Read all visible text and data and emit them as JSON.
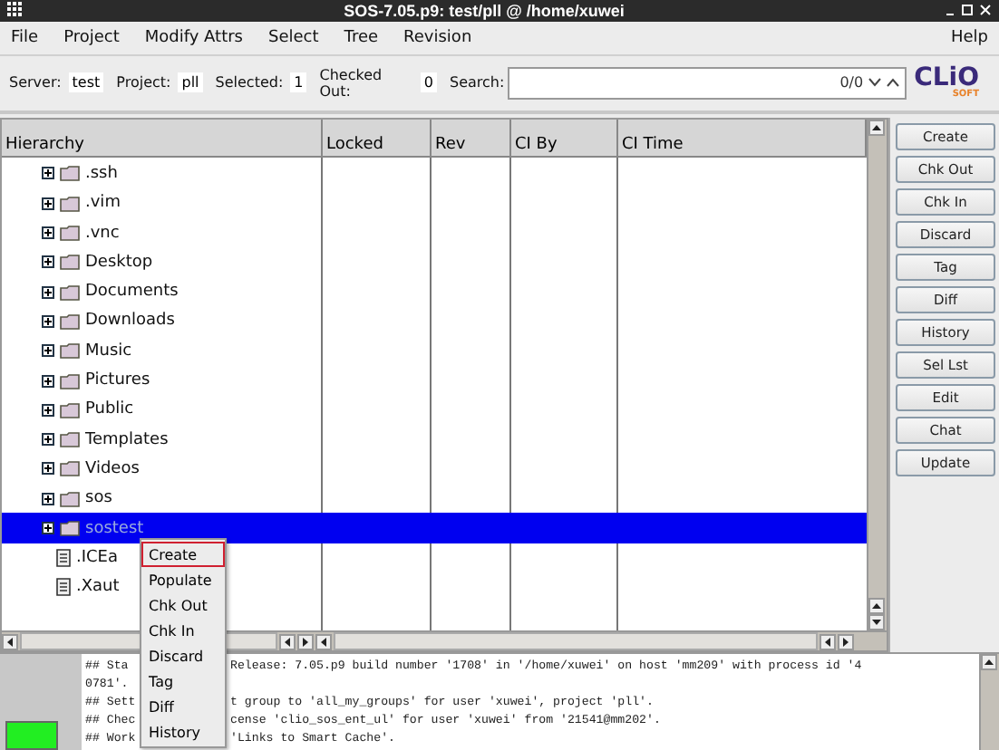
{
  "window": {
    "title": "SOS-7.05.p9: test/pll @ /home/xuwei"
  },
  "menu_bar": {
    "left": [
      "File",
      "Project",
      "Modify Attrs",
      "Select",
      "Tree",
      "Revision"
    ],
    "right": [
      "Help"
    ]
  },
  "info_bar": {
    "fields": [
      {
        "label": "Server:",
        "value": "test"
      },
      {
        "label": "Project:",
        "value": "pll"
      },
      {
        "label": "Selected:",
        "value": "1"
      },
      {
        "label": "Checked Out:",
        "value": "0"
      }
    ],
    "search": {
      "label": "Search:",
      "count": "0/0"
    },
    "logo": {
      "name": "CLiO",
      "sub": "SOFT"
    }
  },
  "table": {
    "columns": [
      "Hierarchy",
      "Locked",
      "Rev",
      "CI By",
      "CI Time"
    ],
    "rows": [
      {
        "name": ".ssh",
        "kind": "folder",
        "selected": false
      },
      {
        "name": ".vim",
        "kind": "folder",
        "selected": false
      },
      {
        "name": ".vnc",
        "kind": "folder",
        "selected": false
      },
      {
        "name": "Desktop",
        "kind": "folder",
        "selected": false
      },
      {
        "name": "Documents",
        "kind": "folder",
        "selected": false
      },
      {
        "name": "Downloads",
        "kind": "folder",
        "selected": false
      },
      {
        "name": "Music",
        "kind": "folder",
        "selected": false
      },
      {
        "name": "Pictures",
        "kind": "folder",
        "selected": false
      },
      {
        "name": "Public",
        "kind": "folder",
        "selected": false
      },
      {
        "name": "Templates",
        "kind": "folder",
        "selected": false
      },
      {
        "name": "Videos",
        "kind": "folder",
        "selected": false
      },
      {
        "name": "sos",
        "kind": "folder",
        "selected": false
      },
      {
        "name": "sostest",
        "kind": "folder",
        "selected": true
      },
      {
        "name": ".ICEa",
        "kind": "file",
        "selected": false
      },
      {
        "name": ".Xaut",
        "kind": "file",
        "selected": false
      }
    ]
  },
  "side_buttons": [
    "Create",
    "Chk Out",
    "Chk In",
    "Discard",
    "Tag",
    "Diff",
    "History",
    "Sel Lst",
    "Edit",
    "Chat",
    "Update"
  ],
  "context_menu": [
    {
      "label": "Create",
      "selected": true
    },
    {
      "label": "Populate",
      "selected": false
    },
    {
      "label": "Chk Out",
      "selected": false
    },
    {
      "label": "Chk In",
      "selected": false
    },
    {
      "label": "Discard",
      "selected": false
    },
    {
      "label": "Tag",
      "selected": false
    },
    {
      "label": "Diff",
      "selected": false
    },
    {
      "label": "History",
      "selected": false
    }
  ],
  "log": [
    {
      "left": "## Sta",
      "right": "Release: 7.05.p9 build number '1708' in '/home/xuwei' on host 'mm209' with process id '4"
    },
    {
      "left": "0781'."
    },
    {
      "left": "## Sett",
      "right": "t group to 'all_my_groups' for user 'xuwei', project 'pll'."
    },
    {
      "left": "## Chec",
      "right": "cense 'clio_sos_ent_ul' for user 'xuwei' from '21541@mm202'."
    },
    {
      "left": "## Work",
      "right": "'Links to Smart Cache'."
    }
  ]
}
